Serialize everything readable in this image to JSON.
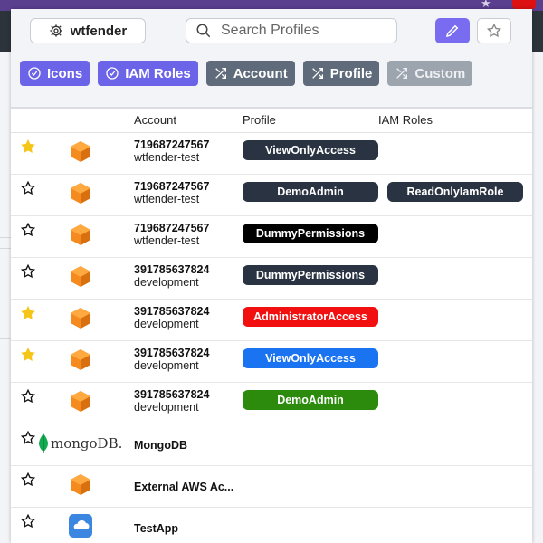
{
  "header": {
    "profile_button_label": "wtfender",
    "search_placeholder": "Search Profiles"
  },
  "chips": [
    {
      "label": "Icons",
      "style": "purple",
      "icon": "check-circle-icon"
    },
    {
      "label": "IAM Roles",
      "style": "purple",
      "icon": "check-circle-icon"
    },
    {
      "label": "Account",
      "style": "gray",
      "icon": "shuffle-icon"
    },
    {
      "label": "Profile",
      "style": "gray",
      "icon": "shuffle-icon"
    },
    {
      "label": "Custom",
      "style": "light",
      "icon": "shuffle-icon"
    }
  ],
  "table": {
    "headers": {
      "account": "Account",
      "profile": "Profile",
      "iam": "IAM Roles"
    },
    "rows": [
      {
        "favorite": true,
        "icon": "aws-cube-icon",
        "account_id": "719687247567",
        "alias": "wtfender-test",
        "profile": "ViewOnlyAccess",
        "profile_color": "#2a3342",
        "iam": ""
      },
      {
        "favorite": false,
        "icon": "aws-cube-icon",
        "account_id": "719687247567",
        "alias": "wtfender-test",
        "profile": "DemoAdmin",
        "profile_color": "#2a3342",
        "iam": "ReadOnlyIamRole",
        "iam_color": "#2a3342"
      },
      {
        "favorite": false,
        "icon": "aws-cube-icon",
        "account_id": "719687247567",
        "alias": "wtfender-test",
        "profile": "DummyPermissions",
        "profile_color": "#000000",
        "iam": ""
      },
      {
        "favorite": false,
        "icon": "aws-cube-icon",
        "account_id": "391785637824",
        "alias": "development",
        "profile": "DummyPermissions",
        "profile_color": "#2a3342",
        "iam": ""
      },
      {
        "favorite": true,
        "icon": "aws-cube-icon",
        "account_id": "391785637824",
        "alias": "development",
        "profile": "AdministratorAccess",
        "profile_color": "#f20f0f",
        "iam": ""
      },
      {
        "favorite": true,
        "icon": "aws-cube-icon",
        "account_id": "391785637824",
        "alias": "development",
        "profile": "ViewOnlyAccess",
        "profile_color": "#1a73f0",
        "iam": ""
      },
      {
        "favorite": false,
        "icon": "aws-cube-icon",
        "account_id": "391785637824",
        "alias": "development",
        "profile": "DemoAdmin",
        "profile_color": "#2c8a0c",
        "iam": ""
      },
      {
        "favorite": false,
        "icon": "mongodb-logo-icon",
        "logo_text": "mongoDB.",
        "name": "MongoDB"
      },
      {
        "favorite": false,
        "icon": "aws-cube-icon",
        "name": "External AWS Ac..."
      },
      {
        "favorite": false,
        "icon": "cloud-app-icon",
        "name": "TestApp"
      }
    ]
  },
  "colors": {
    "accent": "#7a6cf0",
    "chip_purple": "#6b63e8",
    "chip_gray": "#5f6b7a",
    "star_filled": "#f5c518",
    "aws_orange": "#f58a1f",
    "cloud_blue": "#3a86e0"
  }
}
